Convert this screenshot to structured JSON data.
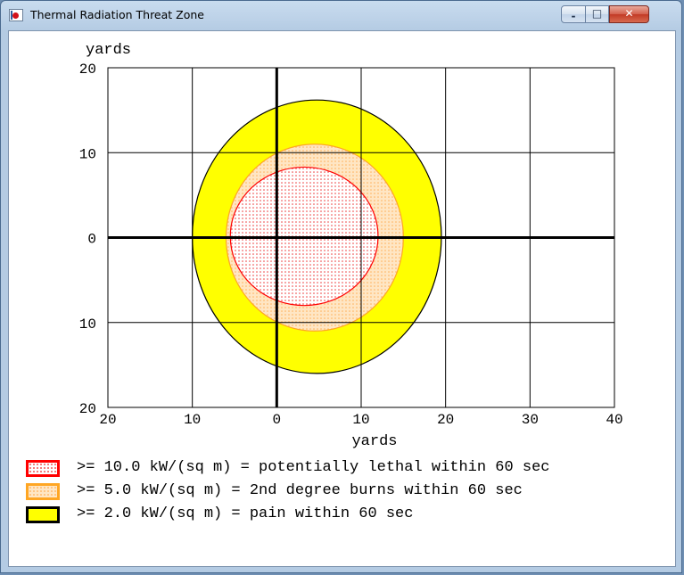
{
  "window": {
    "title": "Thermal Radiation Threat Zone",
    "buttons": {
      "minimize": "-",
      "maximize": "□",
      "close": "✕"
    },
    "icons": [
      "app-icon",
      "minimize-icon",
      "maximize-icon",
      "close-icon"
    ]
  },
  "chart_data": {
    "type": "area",
    "title": "",
    "xlabel": "yards",
    "ylabel": "yards",
    "xlim": [
      -20,
      40
    ],
    "ylim": [
      -20,
      20
    ],
    "x_ticks": [
      -20,
      -10,
      0,
      10,
      20,
      30,
      40
    ],
    "y_ticks": [
      20,
      10,
      0,
      -10,
      -20
    ],
    "x_tick_labels": [
      "20",
      "10",
      "0",
      "10",
      "20",
      "30",
      "40"
    ],
    "y_tick_labels": [
      "20",
      "10",
      "0",
      "10",
      "20"
    ],
    "grid": true,
    "series": [
      {
        "name": ">= 2.0 kW/(sq m) = pain within 60 sec",
        "color": "#ffff00",
        "edge_color": "#000000",
        "center": [
          4,
          0.3
        ],
        "x_extent": [
          -10,
          19.5
        ],
        "y_extent": [
          -16,
          16.2
        ]
      },
      {
        "name": ">= 5.0 kW/(sq m) = 2nd degree burns within 60 sec",
        "color": "#ffe6c4",
        "edge_color": "#ffa623",
        "center": [
          4.5,
          0.2
        ],
        "x_extent": [
          -6,
          15
        ],
        "y_extent": [
          -11,
          11
        ]
      },
      {
        "name": ">= 10.0 kW/(sq m) = potentially lethal within 60 sec",
        "color": "#ffffff",
        "edge_color": "#ff0000",
        "center": [
          3.2,
          0.3
        ],
        "x_extent": [
          -5.5,
          12
        ],
        "y_extent": [
          -8,
          8.3
        ]
      }
    ]
  },
  "legend": {
    "items": [
      {
        "label": ">= 10.0 kW/(sq m) = potentially lethal within 60 sec"
      },
      {
        "label": ">= 5.0 kW/(sq m) = 2nd degree burns within 60 sec"
      },
      {
        "label": ">= 2.0 kW/(sq m) = pain within 60 sec"
      }
    ]
  }
}
